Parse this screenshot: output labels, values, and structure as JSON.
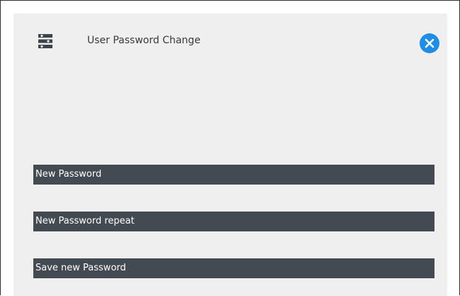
{
  "dialog": {
    "title": "User Password Change",
    "header_icon": "user-settings-icon",
    "close_icon": "close-icon",
    "accent_color": "#1e8de6"
  },
  "form": {
    "new_password_label": "New Password",
    "new_password_repeat_label": "New Password repeat",
    "save_label": "Save new Password"
  }
}
